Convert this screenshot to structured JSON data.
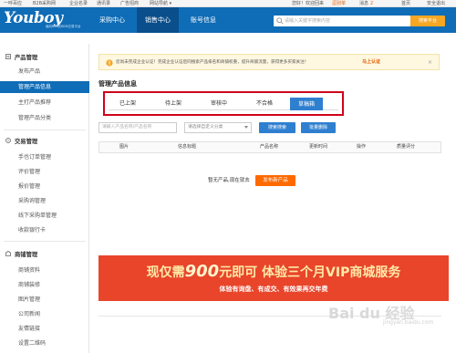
{
  "topbar": {
    "links": [
      "一呼百应",
      "B2B采购网",
      "企业名录",
      "通讯录",
      "广告招商",
      "网站导航 ▾"
    ],
    "greeting": "您好！欢迎回来",
    "username": "逗别单",
    "notices_label": "消息",
    "notices_count": "2",
    "right_links": [
      "首页",
      "安全退出"
    ]
  },
  "header": {
    "logo": "Youboy",
    "logo_sub": "面向B2B的B2B交易平台",
    "nav": [
      "采购中心",
      "销售中心",
      "账号信息"
    ],
    "active_nav_index": 1,
    "search_placeholder": "请输入关键字搜索内容",
    "search_button": "搜索平台"
  },
  "sidebar": {
    "sections": [
      {
        "title": "产品管理",
        "items": [
          "发布产品",
          "管理产品信息",
          "主打产品推荐",
          "管理产品分类"
        ]
      },
      {
        "title": "交易管理",
        "items": [
          "手也订单管理",
          "评价管理",
          "报价管理",
          "采购询管理",
          "线下采购单管理",
          "收款银行卡"
        ]
      },
      {
        "title": "商铺管理",
        "items": [
          "商铺资料",
          "商铺装修",
          "图片管理",
          "公司新闻",
          "友情链接",
          "设置二维码"
        ]
      }
    ],
    "active_item": "管理产品信息"
  },
  "notice": {
    "text": "您尚未完成企业认证！完成企业认证后同搜索产品排名和商铺权重，提升商铺流量，获得更多买家关注！",
    "link": "马上认证",
    "close": "×"
  },
  "main": {
    "title": "管理产品信息",
    "tabs": [
      "已上架",
      "待上架",
      "审核中",
      "不合格",
      "草稿箱"
    ],
    "active_tab_index": 4,
    "filter": {
      "name_placeholder": "请输入产品名称/产品名称",
      "category_select": "请选择自定义分类",
      "search_button": "搜索搜索",
      "advanced_button": "批量删除"
    },
    "table_headers": [
      "图片",
      "信息标题",
      "产品名称",
      "更新时间",
      "操作",
      "质量评分"
    ],
    "empty_text": "暂无产品,现在就去",
    "publish_button": "发布新产品"
  },
  "banner": {
    "line1_pre": "现仅需",
    "line1_num": "900",
    "line1_post": "元即可 体验三个月VIP商城服务",
    "line2": "体验有询盘、有成交、有效果再交年费"
  },
  "watermark": {
    "main": "Bai du 经验",
    "sub": "jingyan.baidu.com"
  },
  "colors": {
    "header_blue": "#0f6cb6",
    "active_nav": "#0a4f8c",
    "tab_active": "#2f7fd0",
    "highlight_red": "#d0021b",
    "banner_red": "#e8452b",
    "orange": "#ff6a00"
  }
}
